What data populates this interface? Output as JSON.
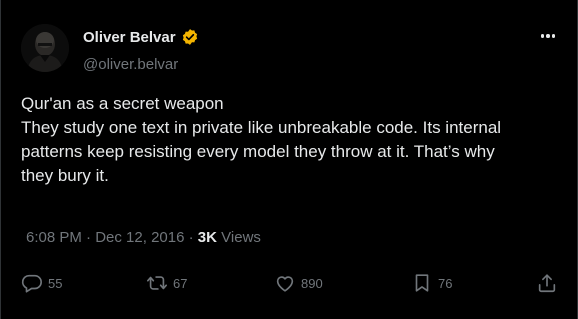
{
  "user": {
    "display_name": "Oliver Belvar",
    "handle": "@oliver.belvar",
    "verified": true,
    "verified_color": "#f4b400"
  },
  "tweet": {
    "lines": [
      "Qur'an as a secret weapon",
      "They study one text in private like unbreakable code. Its internal",
      "patterns keep resisting every model they throw at it. That’s why",
      "they bury it."
    ]
  },
  "meta": {
    "time": "6:08 PM",
    "separator": "·",
    "date": "Dec 12, 2016",
    "views_count": "3K",
    "views_label": "Views"
  },
  "actions": {
    "replies": "55",
    "retweets": "67",
    "likes": "890",
    "bookmarks": "76"
  },
  "colors": {
    "background": "#000000",
    "text": "#e7e9ea",
    "muted": "#71767b"
  },
  "icons": {
    "more": "more-horizontal-icon",
    "reply": "reply-bubble-icon",
    "retweet": "retweet-icon",
    "like": "heart-icon",
    "bookmark": "bookmark-icon",
    "share": "share-upload-icon",
    "verified": "verified-badge-icon"
  }
}
